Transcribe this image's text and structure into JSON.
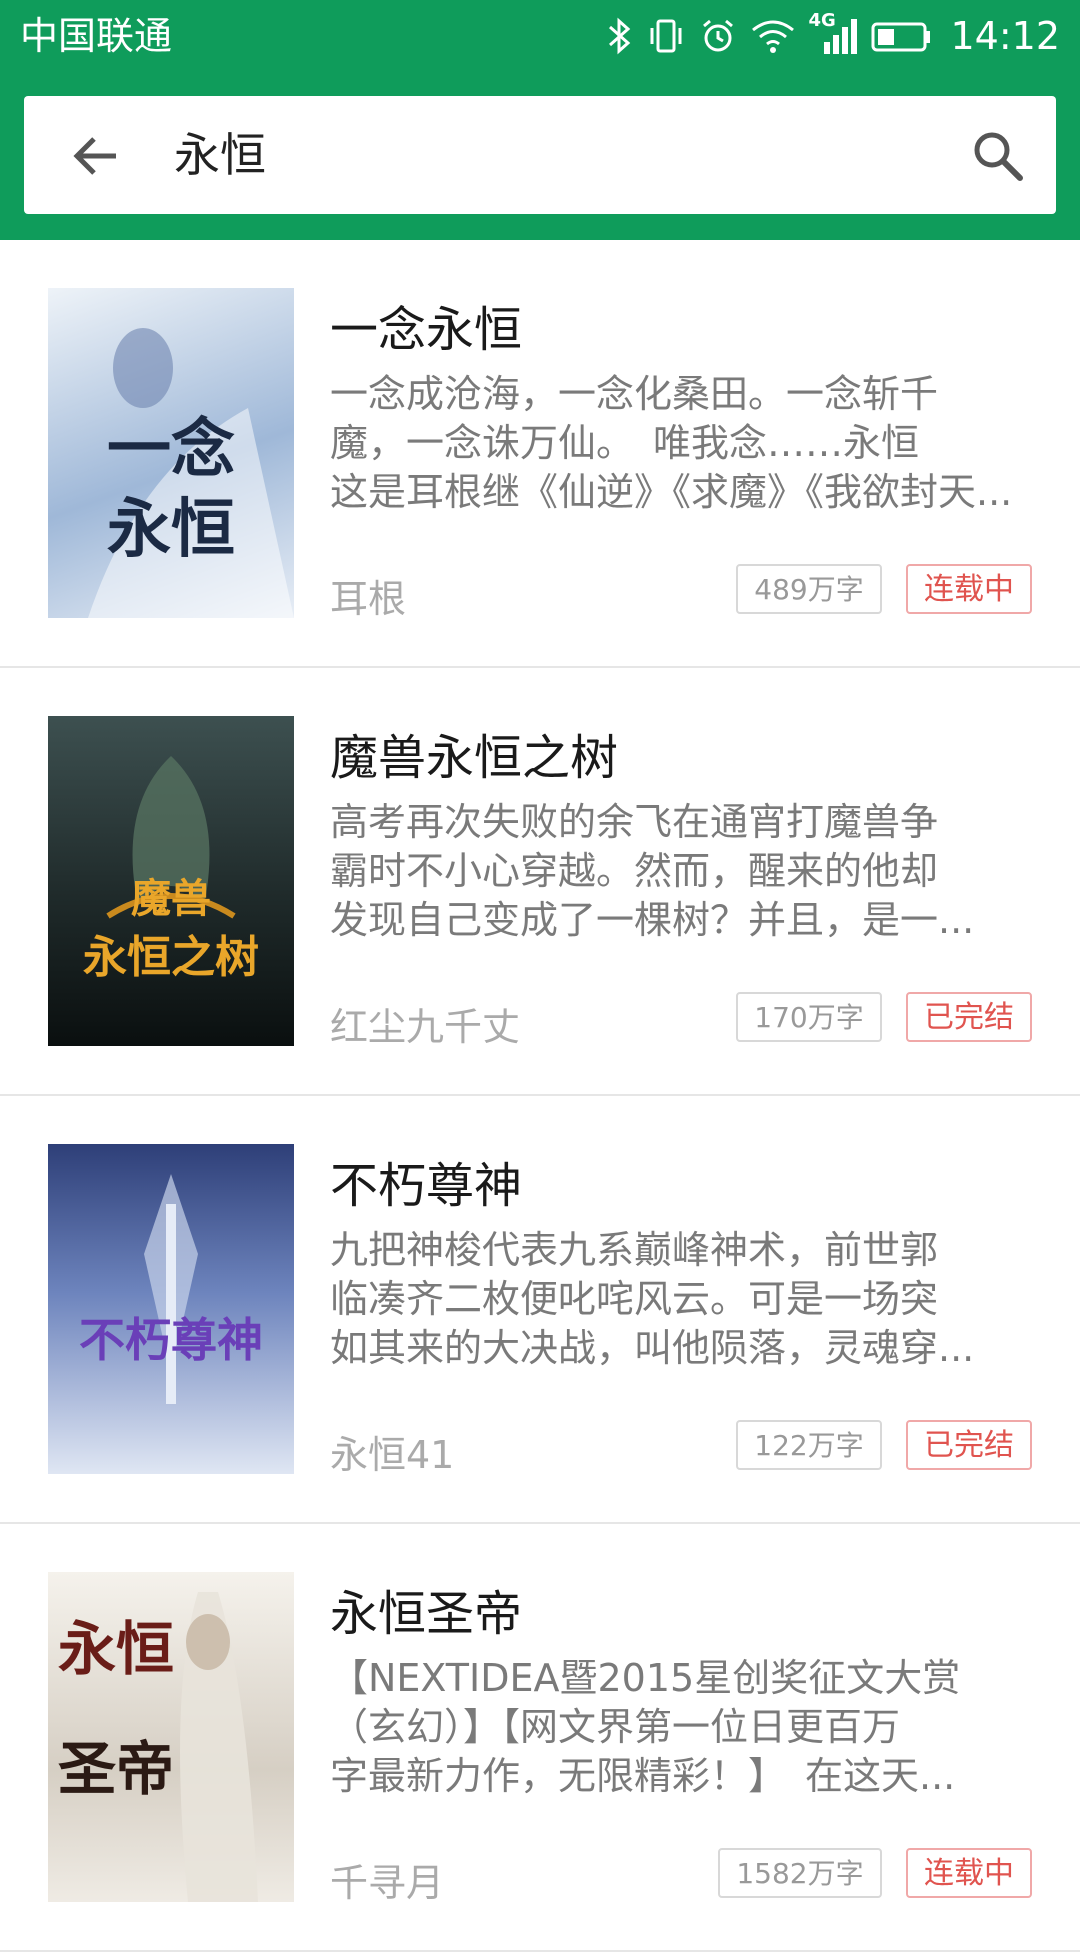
{
  "status_bar": {
    "carrier": "中国联通",
    "network": "4G",
    "time": "14:12"
  },
  "search": {
    "query": "永恒"
  },
  "books": [
    {
      "title": "一念永恒",
      "desc_lines": [
        "一念成沧海，一念化桑田。一念斩千",
        "魔，一念诛万仙。　唯我念……永恒",
        "这是耳根继《仙逆》《求魔》《我欲封天..."
      ],
      "author": "耳根",
      "word_count": "489万字",
      "status": "连载中",
      "cover_text": [
        "一念",
        "永恒"
      ],
      "cover_colors": [
        "#dfe9f3",
        "#7a9cc8"
      ]
    },
    {
      "title": "魔兽永恒之树",
      "desc_lines": [
        "高考再次失败的余飞在通宵打魔兽争",
        "霸时不小心穿越。然而，醒来的他却",
        "发现自己变成了一棵树？并且，是一..."
      ],
      "author": "红尘九千丈",
      "word_count": "170万字",
      "status": "已完结",
      "cover_text": [
        "魔兽",
        "永恒之树"
      ],
      "cover_colors": [
        "#2b3a3a",
        "#0d1414"
      ]
    },
    {
      "title": "不朽尊神",
      "desc_lines": [
        "九把神梭代表九系巅峰神术，前世郭",
        "临凑齐二枚便叱咤风云。可是一场突",
        "如其来的大决战，叫他陨落，灵魂穿..."
      ],
      "author": "永恒41",
      "word_count": "122万字",
      "status": "已完结",
      "cover_text": [
        "不朽尊神"
      ],
      "cover_colors": [
        "#3a4a8a",
        "#c9d6ee"
      ]
    },
    {
      "title": "永恒圣帝",
      "desc_lines": [
        "【NEXTIDEA暨2015星创奖征文大赏",
        "（玄幻）】【网文界第一位日更百万",
        "字最新力作，无限精彩！】　在这天..."
      ],
      "author": "千寻月",
      "word_count": "1582万字",
      "status": "连载中",
      "cover_text": [
        "永恒",
        "圣帝"
      ],
      "cover_colors": [
        "#f1ede6",
        "#bfb7ac"
      ]
    }
  ]
}
